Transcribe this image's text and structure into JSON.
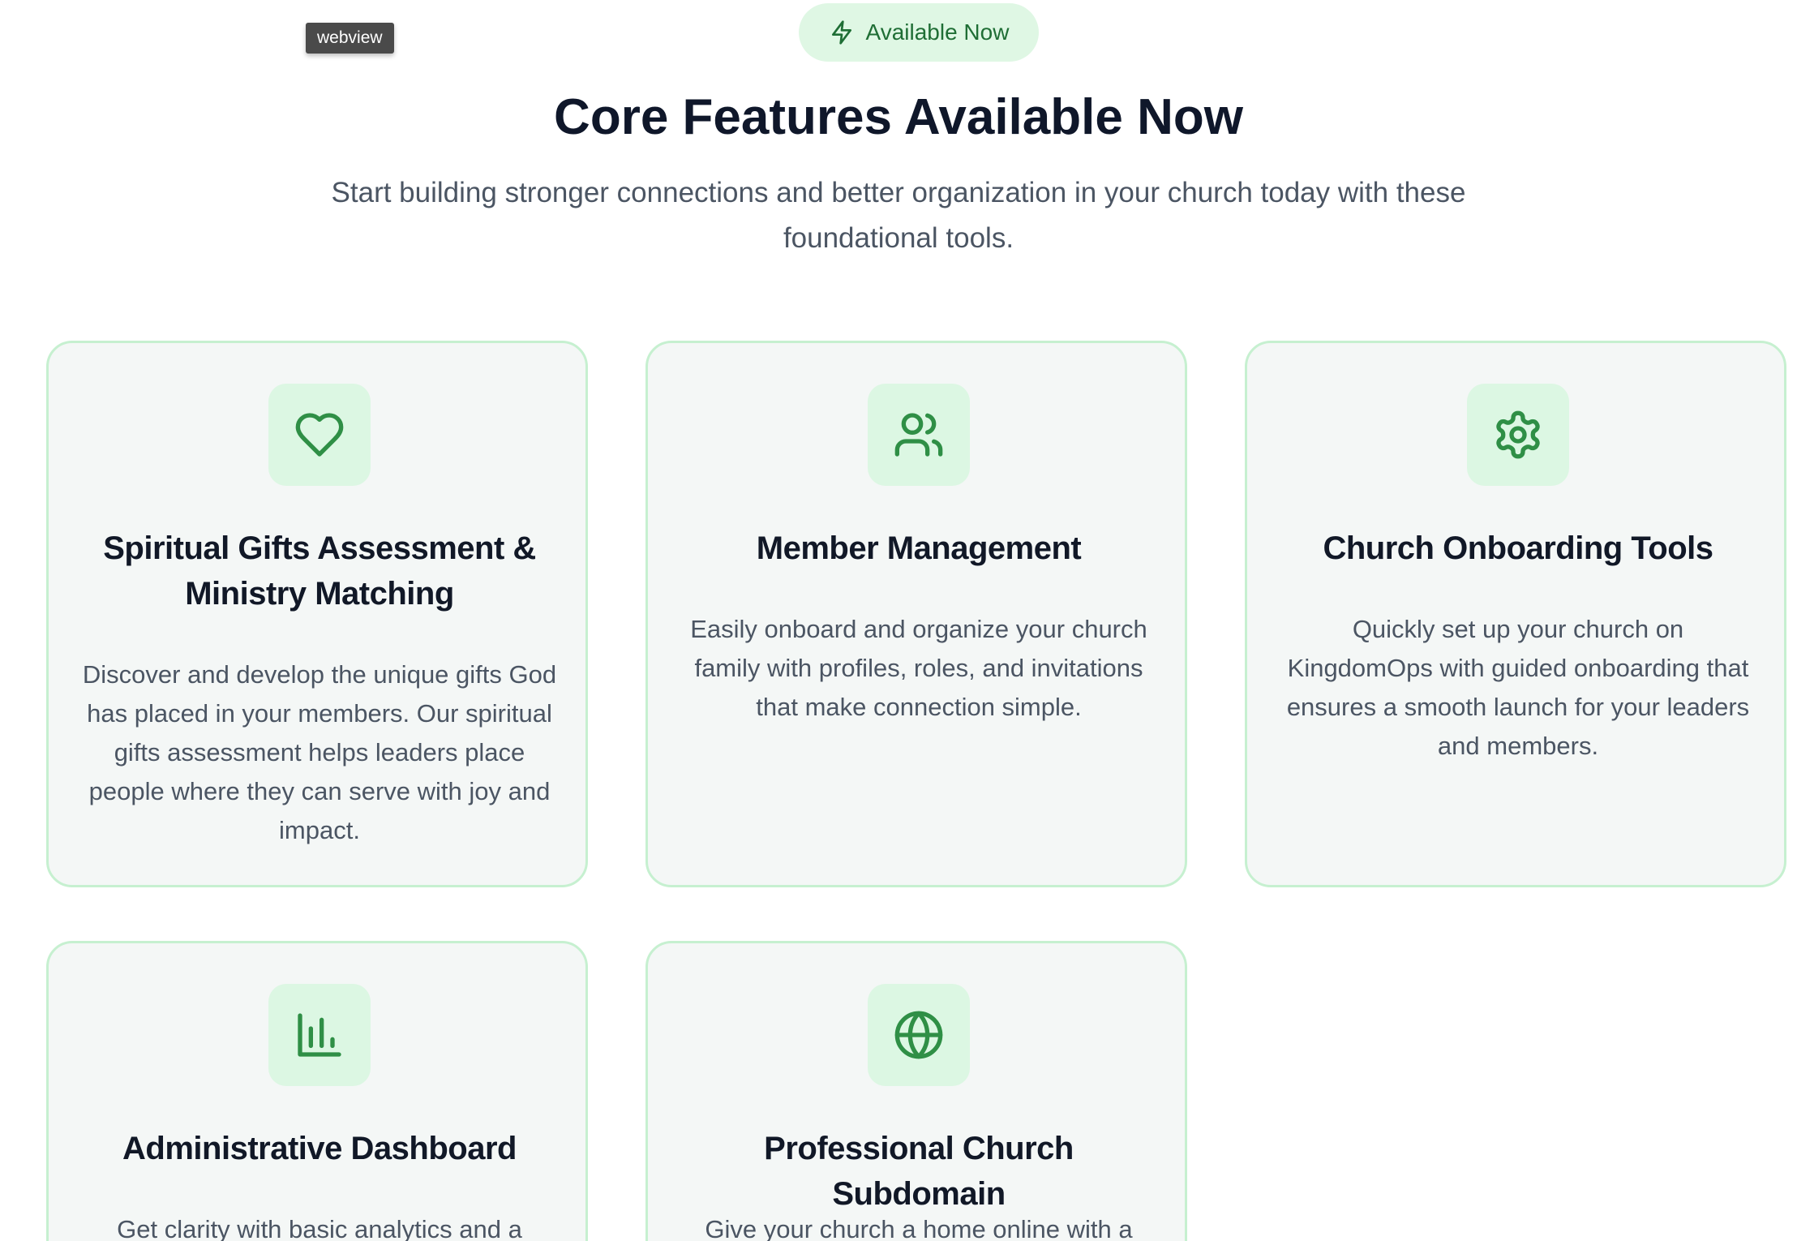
{
  "webview_label": "webview",
  "badge": {
    "label": "Available Now",
    "icon": "lightning-bolt-icon"
  },
  "heading": "Core Features Available Now",
  "subtitle": "Start building stronger connections and better organization in your church today with these foundational tools.",
  "colors": {
    "accent": "#2f8f46",
    "card_bg": "#f4f7f6",
    "card_border": "#c6f0d0",
    "icon_bg": "#dcf7e3"
  },
  "features": [
    {
      "icon": "heart-icon",
      "title": "Spiritual Gifts Assessment & Ministry Matching",
      "description": "Discover and develop the unique gifts God has placed in your members. Our spiritual gifts assessment helps leaders place people where they can serve with joy and impact."
    },
    {
      "icon": "users-icon",
      "title": "Member Management",
      "description": "Easily onboard and organize your church family with profiles, roles, and invitations that make connection simple."
    },
    {
      "icon": "gear-icon",
      "title": "Church Onboarding Tools",
      "description": "Quickly set up your church on KingdomOps with guided onboarding that ensures a smooth launch for your leaders and members."
    },
    {
      "icon": "bar-chart-icon",
      "title": "Administrative Dashboard",
      "description": "Get clarity with basic analytics and a"
    },
    {
      "icon": "globe-icon",
      "title": "Professional Church Subdomain",
      "description": "Give your church a home online with a"
    }
  ]
}
